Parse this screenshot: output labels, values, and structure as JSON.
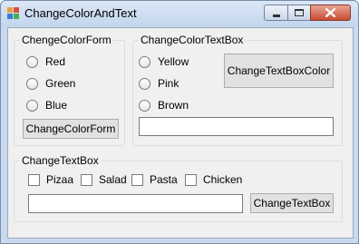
{
  "window": {
    "title": "ChangeColorAndText"
  },
  "color_form_group": {
    "title": "ChengeColorForm",
    "options": [
      "Red",
      "Green",
      "Blue"
    ],
    "button_label": "ChangeColorForm"
  },
  "color_textbox_group": {
    "title": "ChangeColorTextBox",
    "options": [
      "Yellow",
      "Pink",
      "Brown"
    ],
    "button_label": "ChangeTextBoxColor",
    "textbox_value": ""
  },
  "change_text_group": {
    "title": "ChangeTextBox",
    "checkboxes": [
      "Pizaa",
      "Salad",
      "Pasta",
      "Chicken"
    ],
    "textbox_value": "",
    "button_label": "ChangeTextBox"
  }
}
